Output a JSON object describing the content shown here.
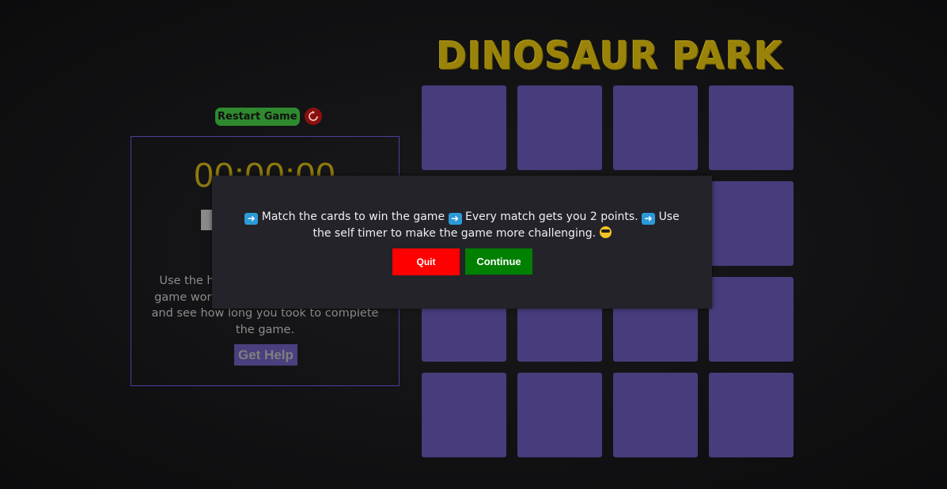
{
  "header": {
    "title": "DINOSAUR PARK"
  },
  "controls": {
    "restart_label": "Restart Game",
    "restart_icon": "refresh-icon"
  },
  "timer": {
    "display": "00:00:00"
  },
  "help": {
    "text": "Use the help button to learn how the game works or you can start the timer and see how long you took to complete the game.",
    "visible_text": "Use the he… game work… timer and see how long you took to complete the game.",
    "button_label": "Get Help"
  },
  "board": {
    "rows": 4,
    "columns": 4,
    "card_color": "#483c7c"
  },
  "modal": {
    "line1_a": "Match the cards to win the game",
    "line1_b": "Every match gets you 2 points.",
    "line1_c": "Use",
    "line2": "the self timer to make the game more challenging.",
    "quit_label": "Quit",
    "continue_label": "Continue"
  },
  "colors": {
    "title": "#9a8309",
    "restart_button": "#2f8a2f",
    "quit": "#ff0000",
    "continue": "#008000",
    "card": "#483c7c"
  }
}
